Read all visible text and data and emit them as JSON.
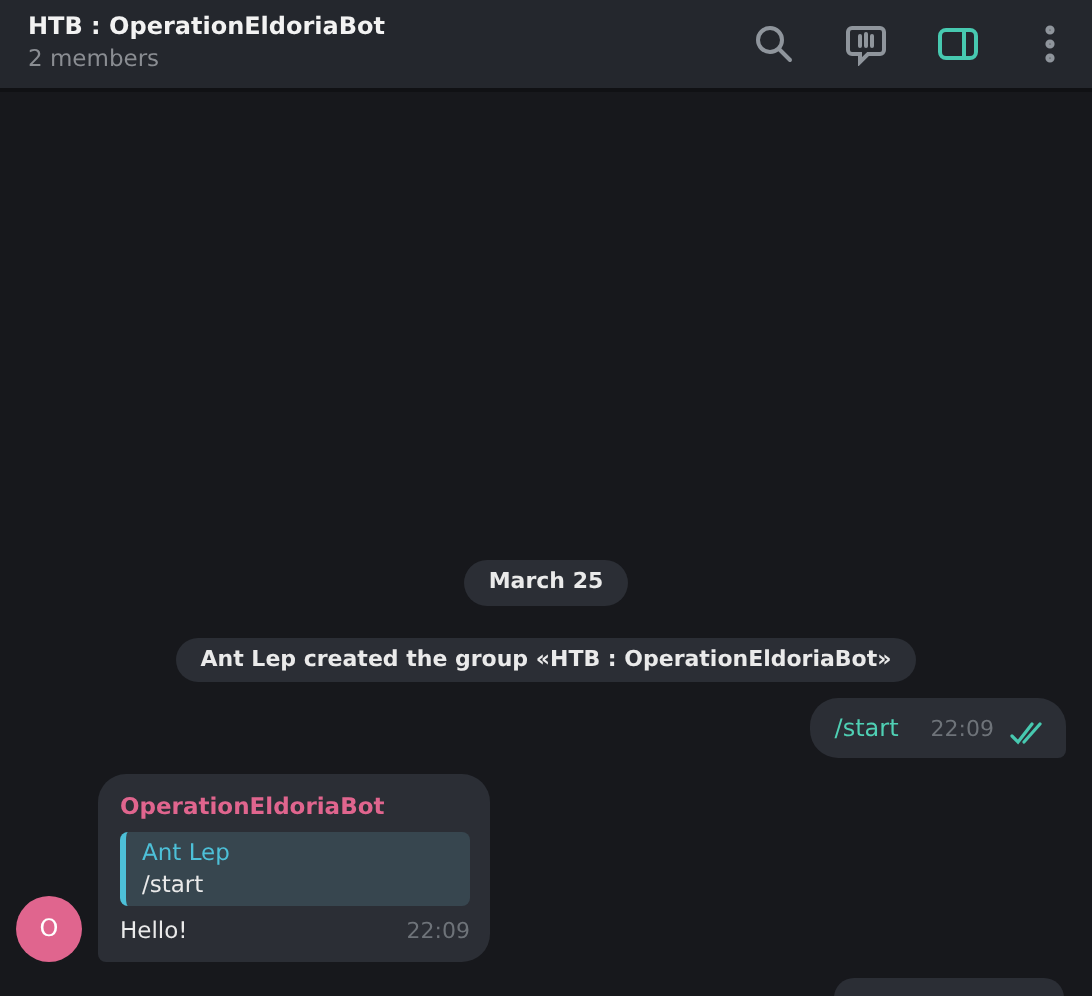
{
  "header": {
    "title": "HTB : OperationEldoriaBot",
    "subtitle": "2 members",
    "buttons": [
      {
        "kind": "search",
        "active": false
      },
      {
        "kind": "live",
        "active": false
      },
      {
        "kind": "sidebar",
        "active": true
      },
      {
        "kind": "more",
        "active": false
      }
    ]
  },
  "messages": [
    {
      "kind": "date",
      "text": "March 25"
    },
    {
      "kind": "service",
      "text": "Ant Lep created the group «HTB : OperationEldoriaBot»"
    },
    {
      "kind": "outgoing",
      "text": "/start",
      "time": "22:09",
      "read": true
    },
    {
      "kind": "incoming",
      "sender": "OperationEldoriaBot",
      "color": "#e0658e",
      "avatar": "O",
      "reply": {
        "author": "Ant Lep",
        "text": "/start"
      },
      "text": "Hello!",
      "time": "22:09"
    },
    {
      "kind": "cutoff"
    }
  ]
}
